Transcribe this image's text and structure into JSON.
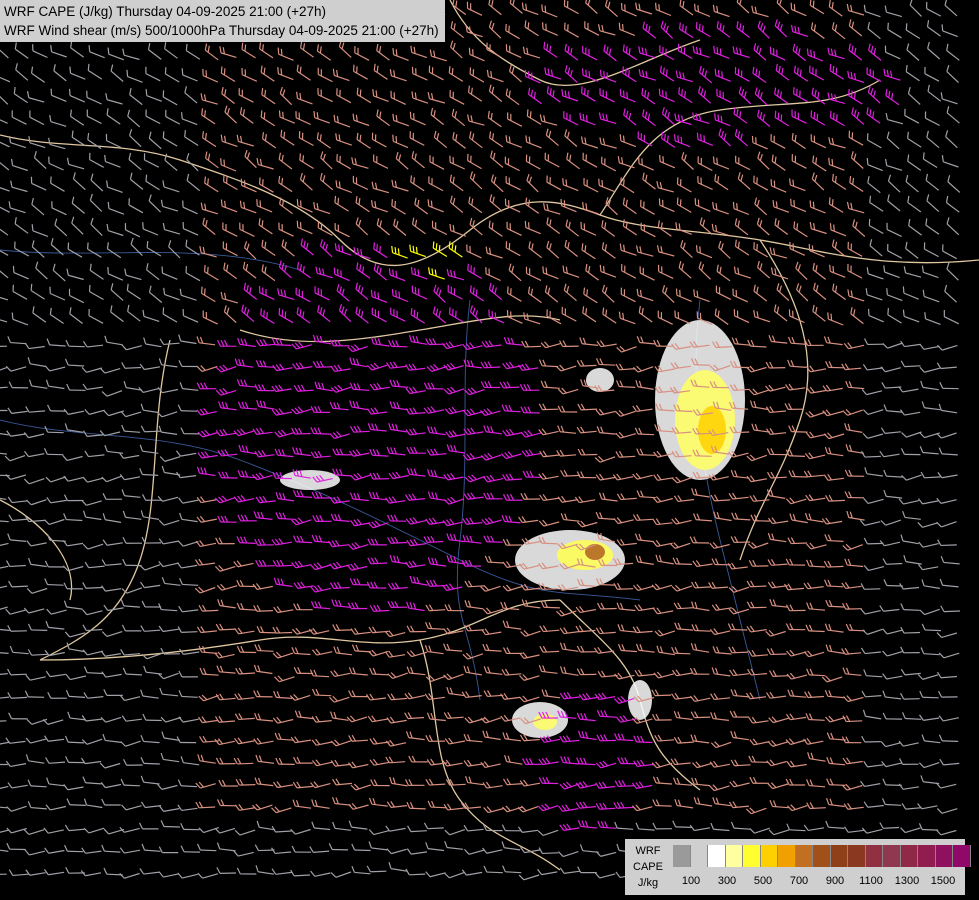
{
  "titles": {
    "line1": "WRF CAPE (J/kg) Thursday 04-09-2025 21:00 (+27h)",
    "line2": "WRF Wind shear (m/s) 500/1000hPa Thursday 04-09-2025 21:00 (+27h)"
  },
  "legend": {
    "label_lines": [
      "WRF",
      "CAPE",
      "J/kg"
    ],
    "tick_labels": [
      "100",
      "300",
      "500",
      "700",
      "900",
      "1100",
      "1300",
      "1500"
    ],
    "colors": [
      "#9a9a9a",
      "#cfcfcf",
      "#ffffff",
      "#ffffa0",
      "#ffff30",
      "#ffd000",
      "#f0a000",
      "#c07020",
      "#a05018",
      "#904018",
      "#8a3820",
      "#903040",
      "#903850",
      "#902848",
      "#901c50",
      "#901060",
      "#900868"
    ]
  },
  "map_colors": {
    "background": "#000000",
    "border": "#e0c8a0",
    "river": "#3a5a9a",
    "barb_low": "#a0a0a8",
    "barb_mid": "#d89080",
    "barb_high": "#e020e0",
    "barb_max": "#ffff00"
  }
}
